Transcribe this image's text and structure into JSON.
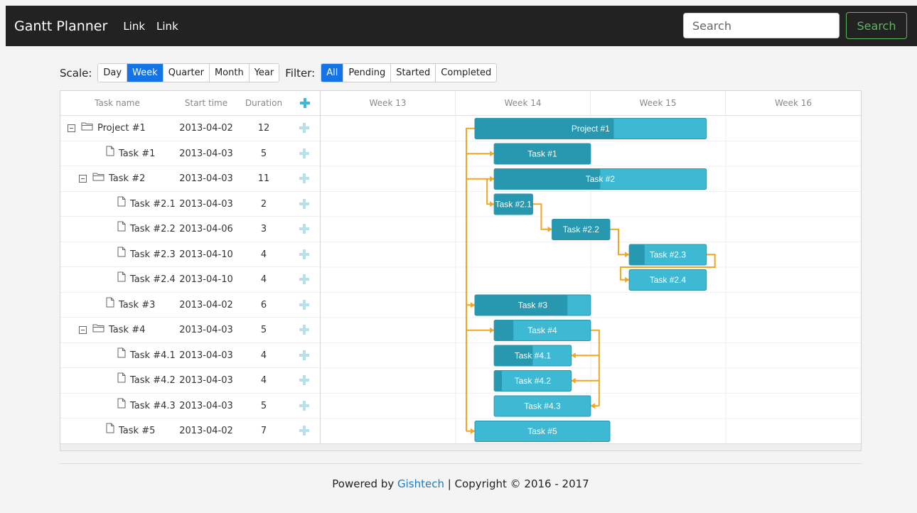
{
  "navbar": {
    "brand": "Gantt Planner",
    "links": [
      "Link",
      "Link"
    ],
    "search_placeholder": "Search",
    "search_button": "Search"
  },
  "toolbar": {
    "scale_label": "Scale:",
    "scale_options": [
      "Day",
      "Week",
      "Quarter",
      "Month",
      "Year"
    ],
    "scale_selected": "Week",
    "filter_label": "Filter:",
    "filter_options": [
      "All",
      "Pending",
      "Started",
      "Completed"
    ],
    "filter_selected": "All"
  },
  "grid": {
    "headers": {
      "name": "Task name",
      "start": "Start time",
      "duration": "Duration"
    },
    "add_icon": "plus-icon",
    "rows": [
      {
        "name": "Project #1",
        "start": "2013-04-02",
        "duration": "12",
        "level": 0,
        "type": "folder"
      },
      {
        "name": "Task #1",
        "start": "2013-04-03",
        "duration": "5",
        "level": 1,
        "type": "file"
      },
      {
        "name": "Task #2",
        "start": "2013-04-03",
        "duration": "11",
        "level": 1,
        "type": "folder"
      },
      {
        "name": "Task #2.1",
        "start": "2013-04-03",
        "duration": "2",
        "level": 2,
        "type": "file"
      },
      {
        "name": "Task #2.2",
        "start": "2013-04-06",
        "duration": "3",
        "level": 2,
        "type": "file"
      },
      {
        "name": "Task #2.3",
        "start": "2013-04-10",
        "duration": "4",
        "level": 2,
        "type": "file"
      },
      {
        "name": "Task #2.4",
        "start": "2013-04-10",
        "duration": "4",
        "level": 2,
        "type": "file"
      },
      {
        "name": "Task #3",
        "start": "2013-04-02",
        "duration": "6",
        "level": 1,
        "type": "file"
      },
      {
        "name": "Task #4",
        "start": "2013-04-03",
        "duration": "5",
        "level": 1,
        "type": "folder"
      },
      {
        "name": "Task #4.1",
        "start": "2013-04-03",
        "duration": "4",
        "level": 2,
        "type": "file"
      },
      {
        "name": "Task #4.2",
        "start": "2013-04-03",
        "duration": "4",
        "level": 2,
        "type": "file"
      },
      {
        "name": "Task #4.3",
        "start": "2013-04-03",
        "duration": "5",
        "level": 2,
        "type": "file"
      },
      {
        "name": "Task #5",
        "start": "2013-04-02",
        "duration": "7",
        "level": 1,
        "type": "file"
      }
    ]
  },
  "timeline": {
    "weeks": [
      "Week 13",
      "Week 14",
      "Week 15",
      "Week 16"
    ],
    "bars": [
      {
        "label": "Project #1",
        "progress": 0.6
      },
      {
        "label": "Task #1",
        "progress": 1.0
      },
      {
        "label": "Task #2",
        "progress": 0.5
      },
      {
        "label": "Task #2.1",
        "progress": 1.0
      },
      {
        "label": "Task #2.2",
        "progress": 1.0
      },
      {
        "label": "Task #2.3",
        "progress": 0.2
      },
      {
        "label": "Task #2.4",
        "progress": 0.0
      },
      {
        "label": "Task #3",
        "progress": 0.8
      },
      {
        "label": "Task #4",
        "progress": 0.2
      },
      {
        "label": "Task #4.1",
        "progress": 0.5
      },
      {
        "label": "Task #4.2",
        "progress": 0.1
      },
      {
        "label": "Task #4.3",
        "progress": 0.0
      },
      {
        "label": "Task #5",
        "progress": 0.0
      }
    ],
    "colors": {
      "bar": "#3db9d3",
      "progress": "#2898b0",
      "bar_border": "#2898b0",
      "link": "#f0a61f"
    }
  },
  "footer": {
    "prefix": "Powered by ",
    "link": "Gishtech",
    "suffix": " | Copyright © 2016 - 2017"
  }
}
